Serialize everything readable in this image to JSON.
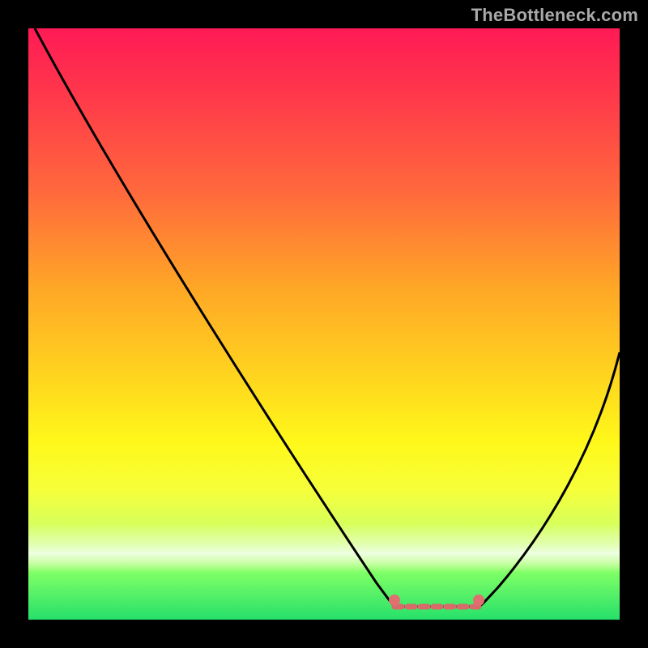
{
  "watermark": "TheBottleneck.com",
  "chart_data": {
    "type": "line",
    "title": "",
    "xlabel": "",
    "ylabel": "",
    "xlim": [
      0,
      100
    ],
    "ylim": [
      0,
      100
    ],
    "grid": false,
    "legend": false,
    "series": [
      {
        "name": "bottleneck-curve",
        "x": [
          0,
          10,
          20,
          30,
          40,
          50,
          58,
          62,
          70,
          76,
          80,
          90,
          100
        ],
        "y": [
          100,
          86,
          72,
          58,
          44,
          30,
          14,
          6,
          2,
          2,
          6,
          26,
          46
        ]
      }
    ],
    "flat_bottom": {
      "x_start": 62,
      "x_end": 76,
      "y": 2
    },
    "markers": [
      {
        "x": 62,
        "y": 5,
        "color": "#e07070"
      },
      {
        "x": 76,
        "y": 5,
        "color": "#e07070"
      }
    ],
    "flat_segment_color": "#d86a6a",
    "curve_color": "#000000",
    "gradient_stops": [
      {
        "pos": 0,
        "color": "#ff1a55"
      },
      {
        "pos": 28,
        "color": "#ff6a3c"
      },
      {
        "pos": 58,
        "color": "#ffd21f"
      },
      {
        "pos": 78,
        "color": "#f6ff3a"
      },
      {
        "pos": 100,
        "color": "#26e06a"
      }
    ]
  }
}
